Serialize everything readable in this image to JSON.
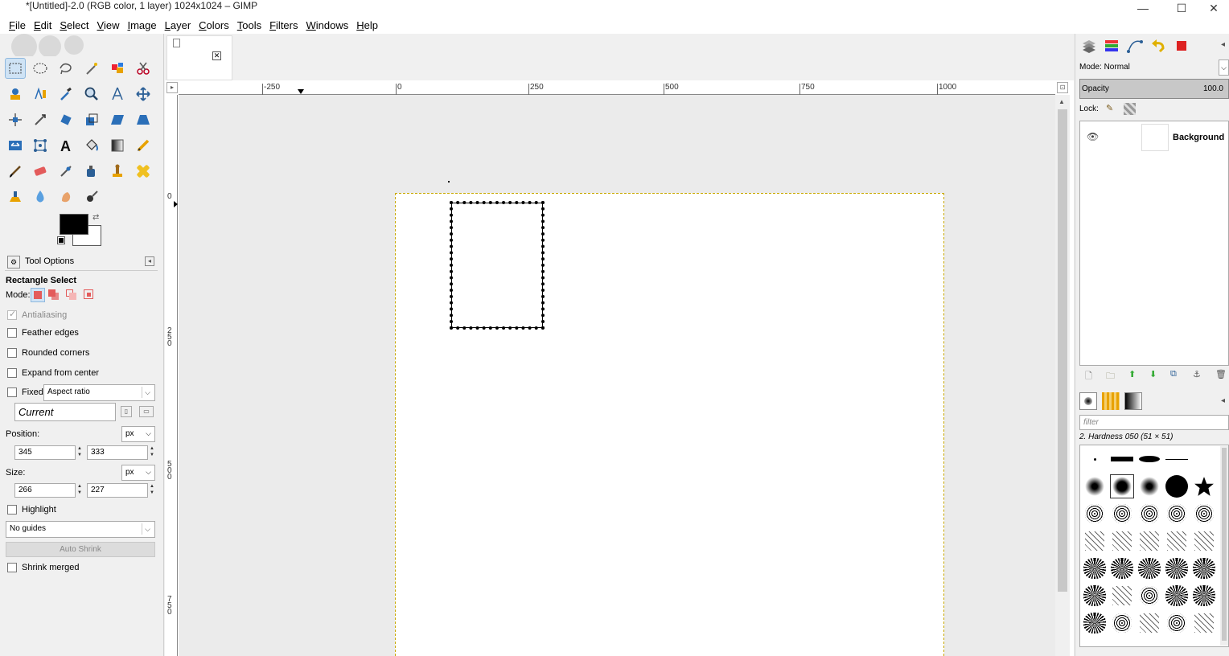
{
  "window": {
    "title": "*[Untitled]-2.0 (RGB color, 1 layer) 1024x1024 – GIMP",
    "minimize": "—",
    "maximize": "☐",
    "close": "✕"
  },
  "menu": [
    {
      "label": "File",
      "mnemonic": "F",
      "rest": "ile"
    },
    {
      "label": "Edit",
      "mnemonic": "E",
      "rest": "dit"
    },
    {
      "label": "Select",
      "mnemonic": "S",
      "rest": "elect"
    },
    {
      "label": "View",
      "mnemonic": "V",
      "rest": "iew"
    },
    {
      "label": "Image",
      "mnemonic": "I",
      "rest": "mage"
    },
    {
      "label": "Layer",
      "mnemonic": "L",
      "rest": "ayer"
    },
    {
      "label": "Colors",
      "mnemonic": "C",
      "rest": "olors"
    },
    {
      "label": "Tools",
      "mnemonic": "T",
      "rest": "ools"
    },
    {
      "label": "Filters",
      "mnemonic": "F",
      "rest": "ilters"
    },
    {
      "label": "Windows",
      "mnemonic": "W",
      "rest": "indows"
    },
    {
      "label": "Help",
      "mnemonic": "H",
      "rest": "elp"
    }
  ],
  "tool_options": {
    "tab_label": "Tool Options",
    "tool_name": "Rectangle Select",
    "mode_label": "Mode:",
    "antialiasing": "Antialiasing",
    "feather_edges": "Feather edges",
    "rounded_corners": "Rounded corners",
    "expand_from_center": "Expand from center",
    "fixed_label": "Fixed:",
    "fixed_value": "Aspect ratio",
    "current_value": "Current",
    "position_label": "Position:",
    "position_unit": "px",
    "position_x": "345",
    "position_y": "333",
    "size_label": "Size:",
    "size_unit": "px",
    "size_w": "266",
    "size_h": "227",
    "highlight": "Highlight",
    "guides_value": "No guides",
    "auto_shrink": "Auto Shrink",
    "shrink_merged": "Shrink merged"
  },
  "rulers": {
    "h_labels": [
      "-250",
      "0",
      "250",
      "500",
      "750",
      "1000"
    ],
    "v_labels": [
      "0",
      "250",
      "500",
      "750"
    ]
  },
  "layers": {
    "mode_label": "Mode:",
    "mode_value": "Normal",
    "opacity_label": "Opacity",
    "opacity_value": "100.0",
    "lock_label": "Lock:",
    "layer_name": "Background"
  },
  "brushes": {
    "filter_placeholder": "filter",
    "selected_brush": "2. Hardness 050 (51 × 51)"
  },
  "colors": {
    "accent_selection": "#cfe3f5",
    "image_boundary": "#c8a800",
    "foreground": "#000000",
    "background": "#ffffff"
  }
}
